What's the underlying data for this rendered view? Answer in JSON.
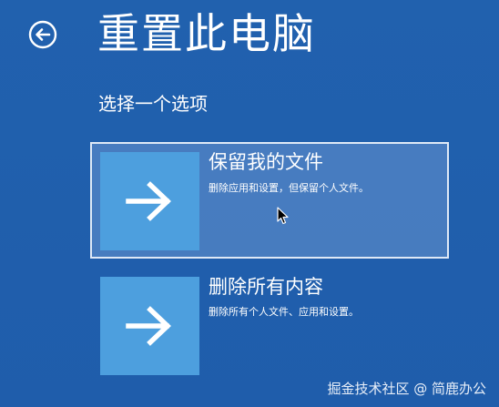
{
  "header": {
    "title": "重置此电脑",
    "back_icon": "back-arrow-circle-icon"
  },
  "subtitle": "选择一个选项",
  "options": [
    {
      "title": "保留我的文件",
      "description": "删除应用和设置，但保留个人文件。",
      "icon": "arrow-right-icon",
      "selected": true
    },
    {
      "title": "删除所有内容",
      "description": "删除所有个人文件、应用和设置。",
      "icon": "arrow-right-icon",
      "selected": false
    }
  ],
  "watermark": "掘金技术社区 @ 简鹿办公",
  "colors": {
    "background": "#1f5fad",
    "tile": "#4d9fde",
    "selected_border": "#dfe9f6",
    "text": "#ffffff"
  }
}
